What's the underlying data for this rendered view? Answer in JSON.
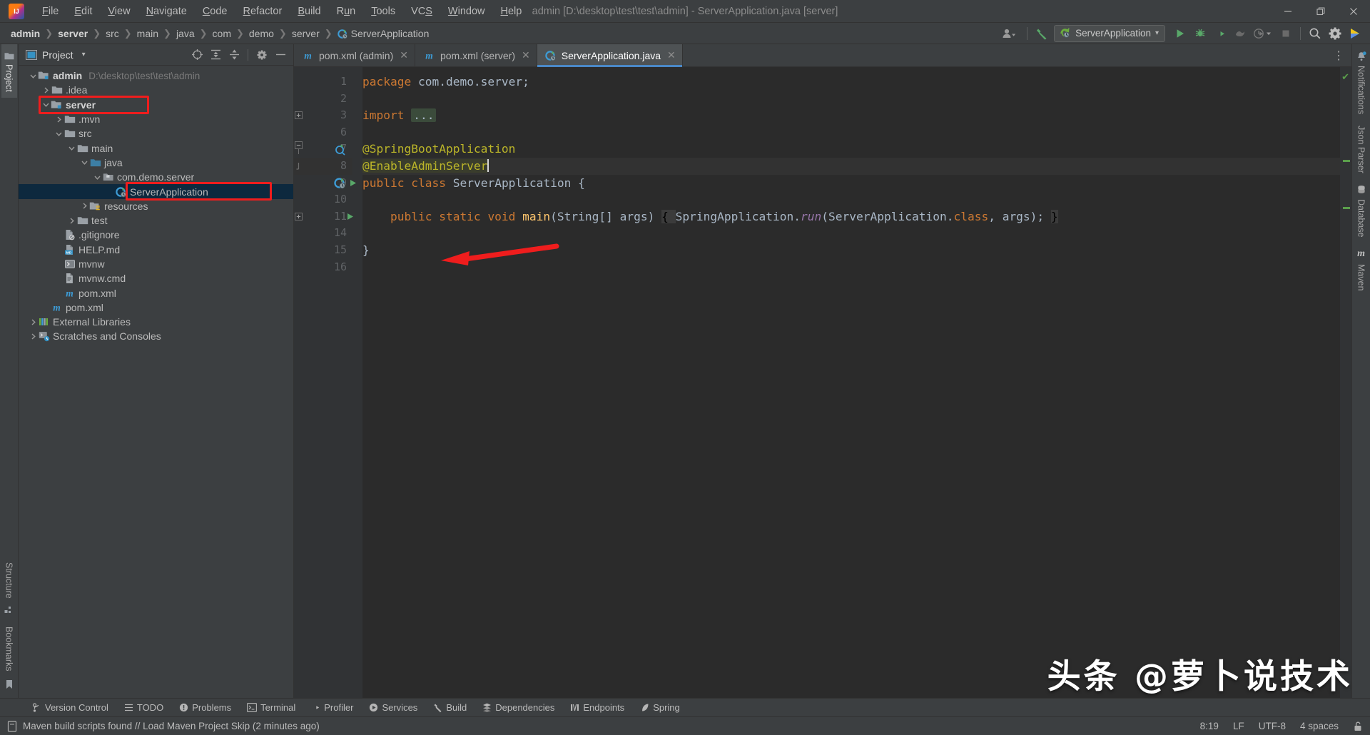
{
  "window": {
    "title": "admin [D:\\desktop\\test\\test\\admin] - ServerApplication.java [server]",
    "app_logo": "intellij-idea-logo",
    "minimize": "–",
    "maximize": "❐",
    "close": "✕"
  },
  "menu": [
    {
      "label": "File",
      "mnemonic": "F"
    },
    {
      "label": "Edit",
      "mnemonic": "E"
    },
    {
      "label": "View",
      "mnemonic": "V"
    },
    {
      "label": "Navigate",
      "mnemonic": "N"
    },
    {
      "label": "Code",
      "mnemonic": "C"
    },
    {
      "label": "Refactor",
      "mnemonic": "R"
    },
    {
      "label": "Build",
      "mnemonic": "B"
    },
    {
      "label": "Run",
      "mnemonic": "u"
    },
    {
      "label": "Tools",
      "mnemonic": "T"
    },
    {
      "label": "VCS",
      "mnemonic": "S"
    },
    {
      "label": "Window",
      "mnemonic": "W"
    },
    {
      "label": "Help",
      "mnemonic": "H"
    }
  ],
  "breadcrumb": [
    {
      "label": "admin",
      "bold": true
    },
    {
      "label": "server",
      "bold": true
    },
    {
      "label": "src",
      "bold": false
    },
    {
      "label": "main",
      "bold": false
    },
    {
      "label": "java",
      "bold": false
    },
    {
      "label": "com",
      "bold": false
    },
    {
      "label": "demo",
      "bold": false
    },
    {
      "label": "server",
      "bold": false
    },
    {
      "label": "ServerApplication",
      "bold": false,
      "icon": "spring-boot-class-icon"
    }
  ],
  "navbar_right": {
    "user_icon": "account-icon",
    "chevron": "▾",
    "hammer_icon": "build-hammer-icon",
    "run_config": "ServerApplication",
    "run_config_icon": "spring-boot-icon",
    "run_config_chevron": "▾",
    "actions": [
      {
        "name": "run-button",
        "glyph": "▶"
      },
      {
        "name": "debug-button",
        "glyph": "bug"
      },
      {
        "name": "run-with-coverage-button",
        "glyph": "coverage"
      },
      {
        "name": "profiler-button",
        "glyph": "profiler"
      },
      {
        "name": "run-history-button",
        "glyph": "history"
      },
      {
        "name": "stop-button",
        "glyph": "■"
      },
      {
        "name": "search-everywhere-button",
        "glyph": "search"
      },
      {
        "name": "settings-button",
        "glyph": "gear"
      },
      {
        "name": "ide-assistant-button",
        "glyph": "assistant"
      }
    ]
  },
  "left_strip": {
    "top": [
      {
        "label": "Project",
        "icon": "project-folder-icon",
        "selected": true
      }
    ],
    "bottom": [
      {
        "label": "Structure",
        "icon": "structure-icon",
        "selected": false
      },
      {
        "label": "Bookmarks",
        "icon": "bookmarks-icon",
        "selected": false
      }
    ]
  },
  "right_strip": [
    {
      "label": "Notifications",
      "icon": "bell-icon"
    },
    {
      "label": "Json Parser",
      "icon": "json-icon"
    },
    {
      "label": "Database",
      "icon": "database-icon"
    },
    {
      "label": "Maven",
      "icon": "maven-icon"
    }
  ],
  "project_panel": {
    "title": "Project",
    "dropdown": "▾",
    "toolbar": [
      {
        "name": "select-opened-file-button",
        "glyph": "target"
      },
      {
        "name": "expand-all-button",
        "glyph": "expand"
      },
      {
        "name": "collapse-all-button",
        "glyph": "collapse"
      },
      {
        "name": "panel-options-button",
        "glyph": "gear"
      },
      {
        "name": "hide-panel-button",
        "glyph": "minus"
      }
    ],
    "tree": [
      {
        "depth": 0,
        "arrow": "down",
        "icon": "module-folder-icon",
        "label": "admin",
        "bold": true,
        "sublabel": "D:\\desktop\\test\\test\\admin"
      },
      {
        "depth": 1,
        "arrow": "right",
        "icon": "folder-icon",
        "label": ".idea",
        "bold": false,
        "sublabel": ""
      },
      {
        "depth": 1,
        "arrow": "down",
        "icon": "module-folder-icon",
        "label": "server",
        "bold": true,
        "sublabel": "",
        "highlight": true
      },
      {
        "depth": 2,
        "arrow": "right",
        "icon": "folder-icon",
        "label": ".mvn",
        "bold": false,
        "sublabel": ""
      },
      {
        "depth": 2,
        "arrow": "down",
        "icon": "folder-icon",
        "label": "src",
        "bold": false,
        "sublabel": ""
      },
      {
        "depth": 3,
        "arrow": "down",
        "icon": "folder-icon",
        "label": "main",
        "bold": false,
        "sublabel": ""
      },
      {
        "depth": 4,
        "arrow": "down",
        "icon": "source-root-icon",
        "label": "java",
        "bold": false,
        "sublabel": ""
      },
      {
        "depth": 5,
        "arrow": "down",
        "icon": "package-icon",
        "label": "com.demo.server",
        "bold": false,
        "sublabel": ""
      },
      {
        "depth": 6,
        "arrow": "none",
        "icon": "spring-boot-class-icon",
        "label": "ServerApplication",
        "bold": false,
        "sublabel": "",
        "selected": true,
        "highlight": true
      },
      {
        "depth": 4,
        "arrow": "right",
        "icon": "resource-root-icon",
        "label": "resources",
        "bold": false,
        "sublabel": ""
      },
      {
        "depth": 3,
        "arrow": "right",
        "icon": "folder-icon",
        "label": "test",
        "bold": false,
        "sublabel": ""
      },
      {
        "depth": 2,
        "arrow": "none",
        "icon": "gitignore-icon",
        "label": ".gitignore",
        "bold": false,
        "sublabel": ""
      },
      {
        "depth": 2,
        "arrow": "none",
        "icon": "markdown-icon",
        "label": "HELP.md",
        "bold": false,
        "sublabel": ""
      },
      {
        "depth": 2,
        "arrow": "none",
        "icon": "shell-script-icon",
        "label": "mvnw",
        "bold": false,
        "sublabel": ""
      },
      {
        "depth": 2,
        "arrow": "none",
        "icon": "cmd-file-icon",
        "label": "mvnw.cmd",
        "bold": false,
        "sublabel": ""
      },
      {
        "depth": 2,
        "arrow": "none",
        "icon": "maven-pom-icon",
        "label": "pom.xml",
        "bold": false,
        "sublabel": ""
      },
      {
        "depth": 1,
        "arrow": "none",
        "icon": "maven-pom-icon",
        "label": "pom.xml",
        "bold": false,
        "sublabel": ""
      },
      {
        "depth": 0,
        "arrow": "right",
        "icon": "libraries-icon",
        "label": "External Libraries",
        "bold": false,
        "sublabel": ""
      },
      {
        "depth": 0,
        "arrow": "right",
        "icon": "scratches-icon",
        "label": "Scratches and Consoles",
        "bold": false,
        "sublabel": ""
      }
    ]
  },
  "editor_tabs": [
    {
      "label": "pom.xml (admin)",
      "icon": "maven-pom-icon",
      "active": false,
      "close": "✕"
    },
    {
      "label": "pom.xml (server)",
      "icon": "maven-pom-icon",
      "active": false,
      "close": "✕"
    },
    {
      "label": "ServerApplication.java",
      "icon": "spring-boot-class-icon",
      "active": true,
      "close": "✕"
    }
  ],
  "editor": {
    "line_numbers": [
      "1",
      "2",
      "3",
      "6",
      "7",
      "8",
      "9",
      "10",
      "11",
      "14",
      "15",
      "16"
    ],
    "lines": [
      {
        "n": "1",
        "segments": [
          {
            "t": "package ",
            "c": "kw"
          },
          {
            "t": "com.demo.server;",
            "c": "plain"
          }
        ]
      },
      {
        "n": "2",
        "segments": []
      },
      {
        "n": "3",
        "segments": [
          {
            "t": "import ",
            "c": "kw"
          },
          {
            "t": "...",
            "c": "fold"
          }
        ],
        "fold_marker": "plus"
      },
      {
        "n": "6",
        "segments": []
      },
      {
        "n": "7",
        "segments": [
          {
            "t": "@SpringBootApplication",
            "c": "ann"
          }
        ],
        "gutter_icon": "spring-bean-icon",
        "fold_marker": "start"
      },
      {
        "n": "8",
        "segments": [
          {
            "t": "@EnableAdminServer",
            "c": "ann ann-bg"
          },
          {
            "t": "|",
            "c": "caret"
          }
        ],
        "fold_marker": "end",
        "current": true
      },
      {
        "n": "9",
        "segments": [
          {
            "t": "public ",
            "c": "kw"
          },
          {
            "t": "class ",
            "c": "kw"
          },
          {
            "t": "ServerApplication ",
            "c": "cls"
          },
          {
            "t": "{",
            "c": "plain"
          }
        ],
        "gutter_icon": "spring-run-icon"
      },
      {
        "n": "10",
        "segments": []
      },
      {
        "n": "11",
        "segments": [
          {
            "t": "    public ",
            "c": "kw"
          },
          {
            "t": "static ",
            "c": "kw"
          },
          {
            "t": "void ",
            "c": "kw"
          },
          {
            "t": "main",
            "c": "mth"
          },
          {
            "t": "(",
            "c": "plain"
          },
          {
            "t": "String",
            "c": "cls"
          },
          {
            "t": "[] args) ",
            "c": "plain"
          },
          {
            "t": "{ ",
            "c": "brace-hl"
          },
          {
            "t": "SpringApplication.",
            "c": "plain"
          },
          {
            "t": "run",
            "c": "stat"
          },
          {
            "t": "(ServerApplication.",
            "c": "plain"
          },
          {
            "t": "class",
            "c": "kw"
          },
          {
            "t": ", args); ",
            "c": "plain"
          },
          {
            "t": "}",
            "c": "brace-hl"
          }
        ],
        "gutter_icon": "run-method-icon",
        "fold_marker": "plus"
      },
      {
        "n": "14",
        "segments": []
      },
      {
        "n": "15",
        "segments": [
          {
            "t": "}",
            "c": "plain"
          }
        ]
      },
      {
        "n": "16",
        "segments": []
      }
    ],
    "inspection_status": "✔"
  },
  "annotation": {
    "arrow_color": "#ef1d1d",
    "highlight_color": "#ef1d1d",
    "points_at": "@EnableAdminServer"
  },
  "tool_windows": [
    {
      "label": "Version Control",
      "icon": "branch-icon"
    },
    {
      "label": "TODO",
      "icon": "todo-list-icon"
    },
    {
      "label": "Problems",
      "icon": "problems-icon"
    },
    {
      "label": "Terminal",
      "icon": "terminal-icon"
    },
    {
      "label": "Profiler",
      "icon": "profiler-icon"
    },
    {
      "label": "Services",
      "icon": "services-icon"
    },
    {
      "label": "Build",
      "icon": "build-hammer-icon"
    },
    {
      "label": "Dependencies",
      "icon": "dependencies-icon"
    },
    {
      "label": "Endpoints",
      "icon": "endpoints-icon"
    },
    {
      "label": "Spring",
      "icon": "spring-leaf-icon"
    }
  ],
  "status_bar": {
    "icon": "notification-page-icon",
    "message": "Maven build scripts found // Load Maven Project  Skip (2 minutes ago)",
    "caret_position": "8:19",
    "line_separator": "LF",
    "encoding": "UTF-8",
    "indent": "4 spaces",
    "lock_icon": "unlocked-icon"
  },
  "watermark": "头条 @萝卜说技术"
}
